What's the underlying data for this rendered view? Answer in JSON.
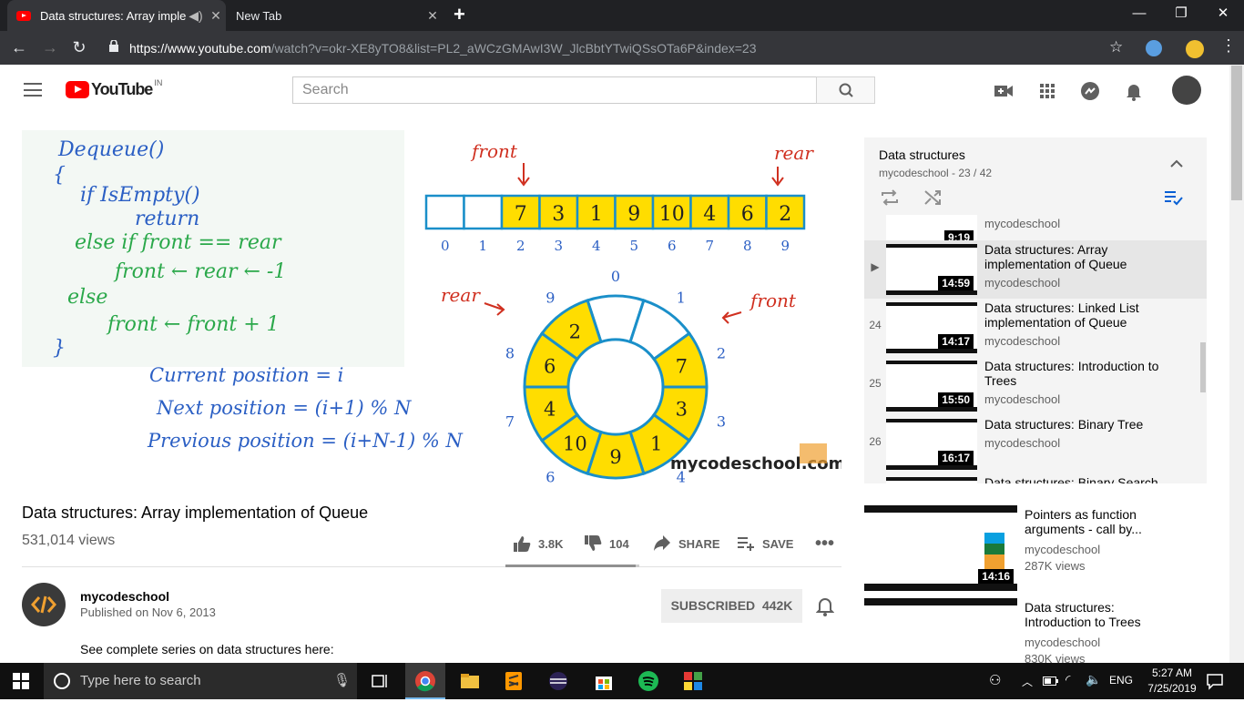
{
  "browser": {
    "tabs": [
      {
        "title": "Data structures: Array implen",
        "active": true
      },
      {
        "title": "New Tab",
        "active": false
      }
    ],
    "new_tab": "+",
    "url_host": "https://www.youtube.com",
    "url_rest": "/watch?v=okr-XE8yTO8&list=PL2_aWCzGMAwI3W_JlcBbtYTwiQSsOTa6P&index=23"
  },
  "youtube": {
    "logo_text": "YouTube",
    "country": "IN",
    "search_placeholder": "Search"
  },
  "video": {
    "title": "Data structures: Array implementation of Queue",
    "views": "531,014 views",
    "likes": "3.8K",
    "dislikes": "104",
    "share": "SHARE",
    "save": "SAVE",
    "watermark": "mycodeschool.com",
    "board": {
      "code": [
        "Dequeue()",
        "{",
        "if IsEmpty()",
        "return",
        "else if  front == rear",
        "front ← rear ← -1",
        "else",
        "front ← front + 1",
        "}"
      ],
      "formulas": [
        "Current position = i",
        "Next position = (i+1) % N",
        "Previous position = (i+N-1) % N"
      ],
      "front_label": "front",
      "rear_label": "rear",
      "array_cells": [
        "",
        "",
        "7",
        "3",
        "1",
        "9",
        "10",
        "4",
        "6",
        "2"
      ],
      "array_indices": [
        "0",
        "1",
        "2",
        "3",
        "4",
        "5",
        "6",
        "7",
        "8",
        "9"
      ]
    }
  },
  "channel": {
    "name": "mycodeschool",
    "published": "Published on Nov 6, 2013",
    "subscribe_label": "SUBSCRIBED",
    "subscribers": "442K",
    "description": "See complete series on data structures here:"
  },
  "playlist": {
    "title": "Data structures",
    "subtitle": "mycodeschool - 23 / 42",
    "items": [
      {
        "num": "",
        "title": "",
        "channel": "mycodeschool",
        "duration": "9:19"
      },
      {
        "num": "▶",
        "title": "Data structures: Array implementation of Queue",
        "channel": "mycodeschool",
        "duration": "14:59"
      },
      {
        "num": "24",
        "title": "Data structures: Linked List implementation of Queue",
        "channel": "mycodeschool",
        "duration": "14:17"
      },
      {
        "num": "25",
        "title": "Data structures: Introduction to Trees",
        "channel": "mycodeschool",
        "duration": "15:50"
      },
      {
        "num": "26",
        "title": "Data structures: Binary Tree",
        "channel": "mycodeschool",
        "duration": "16:17"
      },
      {
        "num": "",
        "title": "Data structures: Binary Search",
        "channel": "",
        "duration": ""
      }
    ]
  },
  "related": [
    {
      "title": "Pointers as function arguments - call by...",
      "channel": "mycodeschool",
      "views": "287K views",
      "duration": "14:16"
    },
    {
      "title": "Data structures: Introduction to Trees",
      "channel": "mycodeschool",
      "views": "830K views",
      "duration": ""
    }
  ],
  "taskbar": {
    "search_placeholder": "Type here to search",
    "language": "ENG",
    "time": "5:27 AM",
    "date": "7/25/2019"
  },
  "colors": {
    "youtube_red": "#ff0000",
    "queue_fill": "#ffdd00",
    "queue_border": "#1a8fc9",
    "chalk_green": "#2aa84a",
    "chalk_blue": "#2b5fc4",
    "chalk_red": "#d03020"
  }
}
